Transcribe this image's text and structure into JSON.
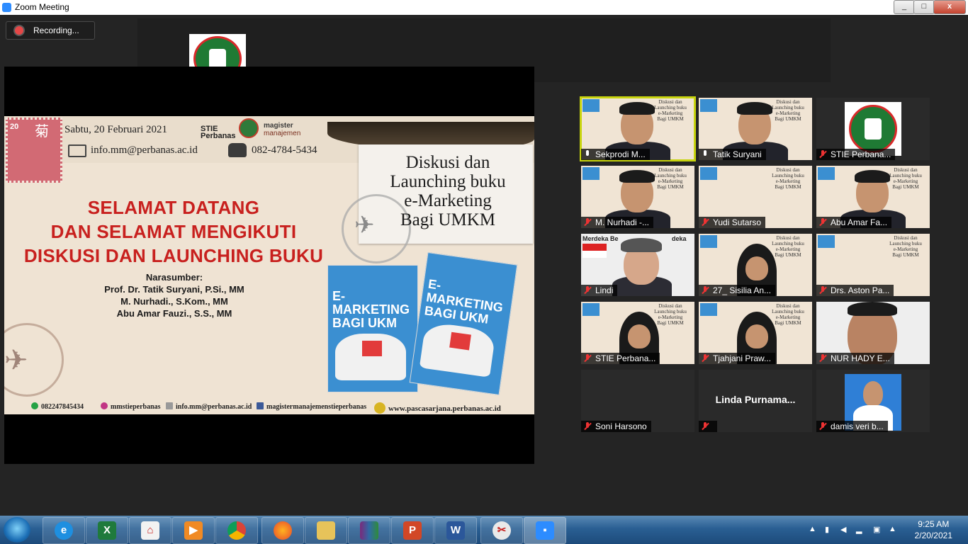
{
  "window": {
    "title": "Zoom Meeting",
    "buttons": [
      "_",
      "□",
      "x"
    ]
  },
  "recording": {
    "label": "Recording..."
  },
  "slide": {
    "stamp_number": "20",
    "stamp_glyph": "菊",
    "date": "Sabtu, 20 Februari 2021",
    "email": "info.mm@perbanas.ac.id",
    "phone": "082-4784-5434",
    "brand_stie": "STIE",
    "brand_perbanas": "Perbanas",
    "brand_magister": "magister",
    "brand_manajemen": "manajemen",
    "heading": [
      "SELAMAT DATANG",
      "DAN SELAMAT MENGIKUTI",
      "DISKUSI DAN LAUNCHING BUKU"
    ],
    "narasumber_label": "Narasumber:",
    "narasumber": [
      "Prof. Dr. Tatik Suryani, P.Si., MM",
      "M. Nurhadi., S.Kom., MM",
      "Abu Amar Fauzi., S.S., MM"
    ],
    "title_lines": [
      "Diskusi dan",
      "Launching buku",
      "e-Marketing",
      "Bagi UMKM"
    ],
    "book_title_lines": [
      "E-MARKETING",
      "BAGI UKM"
    ],
    "footer": {
      "whatsapp": "082247845434",
      "instagram": "mmstieperbanas",
      "email": "info.mm@perbanas.ac.id",
      "facebook": "magistermanajemenstieperbanas",
      "website": "www.pascasarjana.perbanas.ac.id"
    }
  },
  "mini_slide_lines": [
    "Diskusi dan",
    "Launching buku",
    "e-Marketing",
    "Bagi UMKM"
  ],
  "participants": [
    {
      "name": "Sekprodi M...",
      "muted": false,
      "active": true
    },
    {
      "name": "Tatik Suryani",
      "muted": false,
      "active": false
    },
    {
      "name": "STIE Perbana...",
      "muted": true,
      "active": false
    },
    {
      "name": "M. Nurhadi -...",
      "muted": true,
      "active": false
    },
    {
      "name": "Yudi Sutarso",
      "muted": true,
      "active": false
    },
    {
      "name": "Abu Amar Fa...",
      "muted": true,
      "active": false
    },
    {
      "name": "Lindi",
      "muted": true,
      "active": false,
      "banner": "Merdeka Be",
      "banner2": "deka"
    },
    {
      "name": "27_ Sisilia An...",
      "muted": true,
      "active": false
    },
    {
      "name": "Drs. Aston Pa...",
      "muted": true,
      "active": false
    },
    {
      "name": "STIE Perbana...",
      "muted": true,
      "active": false
    },
    {
      "name": "Tjahjani Praw...",
      "muted": true,
      "active": false
    },
    {
      "name": "NUR HADY E...",
      "muted": true,
      "active": false
    },
    {
      "name": "Soni Harsono",
      "muted": true,
      "active": false
    },
    {
      "name": "",
      "muted": true,
      "active": false,
      "display_name": "Linda  Purnama..."
    },
    {
      "name": "damis veri b...",
      "muted": true,
      "active": false
    }
  ],
  "taskbar": {
    "apps": [
      "ie-icon",
      "excel-icon",
      "pdf-icon",
      "media-player-icon",
      "chrome-icon",
      "firefox-icon",
      "folder-icon",
      "winrar-icon",
      "powerpoint-icon",
      "word-icon",
      "snipping-icon",
      "zoom-icon"
    ],
    "excel_letter": "X",
    "word_letter": "W",
    "ppt_letter": "P",
    "clock_time": "9:25 AM",
    "clock_date": "2/20/2021"
  },
  "colors": {
    "heading_red": "#c8201e",
    "zoom_blue": "#2d8cff",
    "active_speaker": "#c8d40e",
    "muted_red": "#e33333"
  }
}
